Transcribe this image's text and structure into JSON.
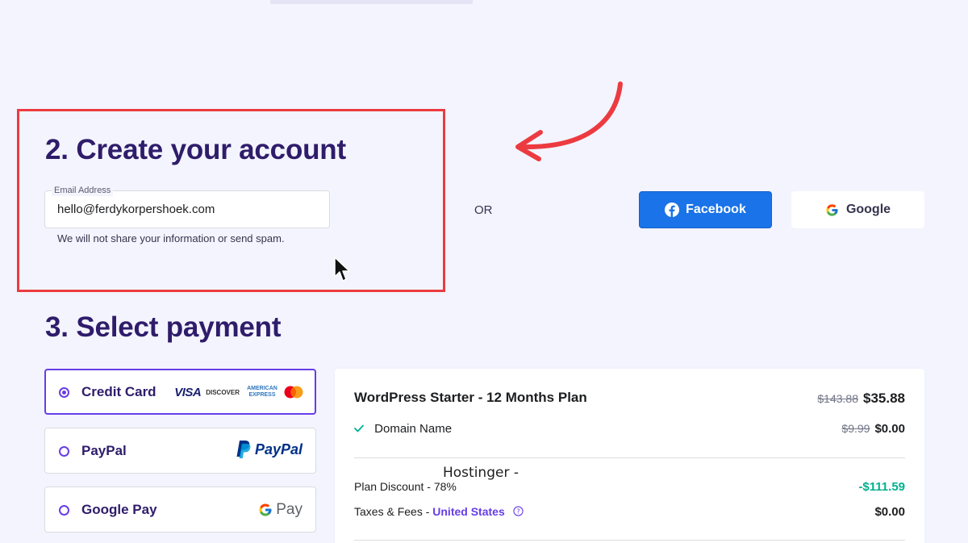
{
  "account": {
    "heading": "2. Create your account",
    "email_label": "Email Address",
    "email_value": "hello@ferdykorpershoek.com",
    "helper_text": "We will not share your information or send spam.",
    "or_text": "OR",
    "facebook_label": "Facebook",
    "google_label": "Google"
  },
  "payment": {
    "heading": "3. Select payment",
    "options": [
      {
        "label": "Credit Card",
        "selected": true,
        "logos": [
          "VISA",
          "DISCOVER",
          "AMERICAN EXPRESS",
          "mastercard-icon"
        ]
      },
      {
        "label": "PayPal",
        "selected": false,
        "logo": "PayPal"
      },
      {
        "label": "Google Pay",
        "selected": false,
        "logo": "Pay"
      }
    ]
  },
  "summary": {
    "plan_title": "WordPress Starter - 12 Months Plan",
    "plan_old_price": "$143.88",
    "plan_price": "$35.88",
    "domain_label": "Domain Name",
    "domain_old_price": "$9.99",
    "domain_price": "$0.00",
    "discount_label": "Plan Discount - 78%",
    "discount_value": "-$111.59",
    "taxes_label": "Taxes & Fees - ",
    "taxes_country": "United States",
    "taxes_value": "$0.00"
  },
  "overlay_text": "Hostinger -",
  "colors": {
    "accent": "#673de6",
    "heading": "#2f1c6a",
    "facebook": "#1a73e8",
    "discount_green": "#00b090",
    "annotation_red": "#ec3b40"
  }
}
